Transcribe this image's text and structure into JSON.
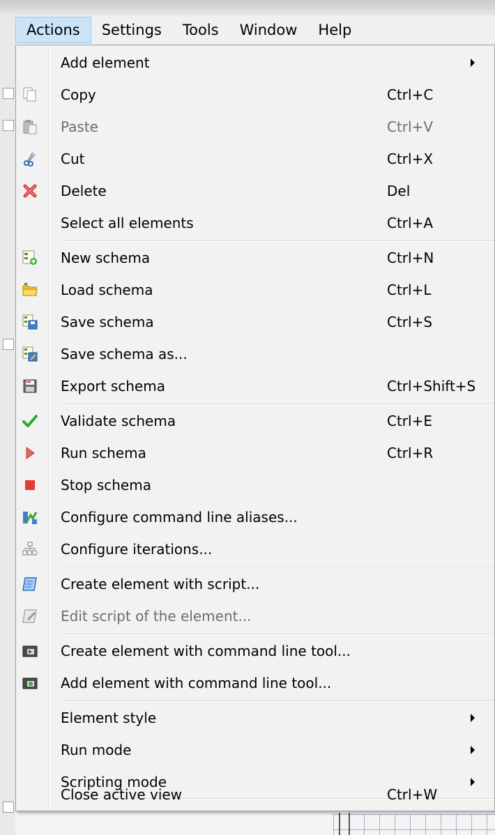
{
  "menubar": {
    "items": [
      {
        "label": "Actions"
      },
      {
        "label": "Settings"
      },
      {
        "label": "Tools"
      },
      {
        "label": "Window"
      },
      {
        "label": "Help"
      }
    ]
  },
  "actions_menu": {
    "items": [
      {
        "label": "Add element",
        "shortcut": "",
        "icon": "none"
      },
      {
        "label": "Copy",
        "shortcut": "Ctrl+C",
        "icon": "copy-icon"
      },
      {
        "label": "Paste",
        "shortcut": "Ctrl+V",
        "icon": "paste-icon"
      },
      {
        "label": "Cut",
        "shortcut": "Ctrl+X",
        "icon": "cut-icon"
      },
      {
        "label": "Delete",
        "shortcut": "Del",
        "icon": "delete-icon"
      },
      {
        "label": "Select all elements",
        "shortcut": "Ctrl+A",
        "icon": "none"
      },
      {
        "label": "New schema",
        "shortcut": "Ctrl+N",
        "icon": "new-schema-icon"
      },
      {
        "label": "Load schema",
        "shortcut": "Ctrl+L",
        "icon": "folder-icon"
      },
      {
        "label": "Save schema",
        "shortcut": "Ctrl+S",
        "icon": "save-schema-icon"
      },
      {
        "label": "Save schema as...",
        "shortcut": "",
        "icon": "save-as-icon"
      },
      {
        "label": "Export schema",
        "shortcut": "Ctrl+Shift+S",
        "icon": "export-icon"
      },
      {
        "label": "Validate schema",
        "shortcut": "Ctrl+E",
        "icon": "checkmark-icon"
      },
      {
        "label": "Run schema",
        "shortcut": "Ctrl+R",
        "icon": "run-icon"
      },
      {
        "label": "Stop schema",
        "shortcut": "",
        "icon": "stop-icon"
      },
      {
        "label": "Configure command line aliases...",
        "shortcut": "",
        "icon": "aliases-icon"
      },
      {
        "label": "Configure iterations...",
        "shortcut": "",
        "icon": "iterations-icon"
      },
      {
        "label": "Create element with script...",
        "shortcut": "",
        "icon": "script-icon"
      },
      {
        "label": "Edit script of the element...",
        "shortcut": "",
        "icon": "edit-script-icon"
      },
      {
        "label": "Create element with command line tool...",
        "shortcut": "",
        "icon": "cmd-tool-icon"
      },
      {
        "label": "Add element with command line tool...",
        "shortcut": "",
        "icon": "cmd-tool-add-icon"
      },
      {
        "label": "Element style",
        "shortcut": "",
        "icon": "none"
      },
      {
        "label": "Run mode",
        "shortcut": "",
        "icon": "none"
      },
      {
        "label": "Scripting mode",
        "shortcut": "",
        "icon": "none"
      },
      {
        "label": "Close active view",
        "shortcut": "Ctrl+W",
        "icon": "none"
      }
    ]
  },
  "colors": {
    "menu_bg": "#f2f2f2",
    "active_bg": "#cce4f7",
    "disabled_text": "#6d6d6d",
    "stop_red": "#e53935",
    "check_green": "#2eaa2e"
  }
}
